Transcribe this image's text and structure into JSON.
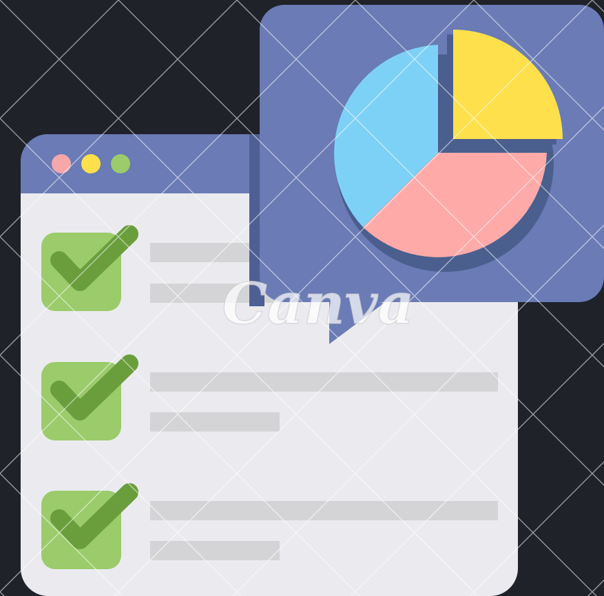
{
  "watermark": {
    "text": "Canva"
  },
  "colors": {
    "background": "#1f2229",
    "window_header": "#6a7bb5",
    "window_body": "#ebebef",
    "dot_red": "#f5a7a9",
    "dot_yellow": "#fde04c",
    "dot_green": "#9bcb6b",
    "checkbox": "#9bcb6b",
    "checkmark": "#6a9e3c",
    "text_line": "#d4d4d6",
    "bubble": "#6a7bb5",
    "bubble_shadow": "#4e5f94",
    "pie_blue": "#7ed1f6",
    "pie_yellow": "#fde04c",
    "pie_pink": "#fdaaa9",
    "pie_shadow": "#4a5f8e"
  },
  "icons": {
    "window_dots": [
      "red-dot-icon",
      "yellow-dot-icon",
      "green-dot-icon"
    ],
    "list_checks": [
      "checkbox-icon",
      "checkbox-icon",
      "checkbox-icon"
    ],
    "pie": "pie-chart-icon"
  }
}
